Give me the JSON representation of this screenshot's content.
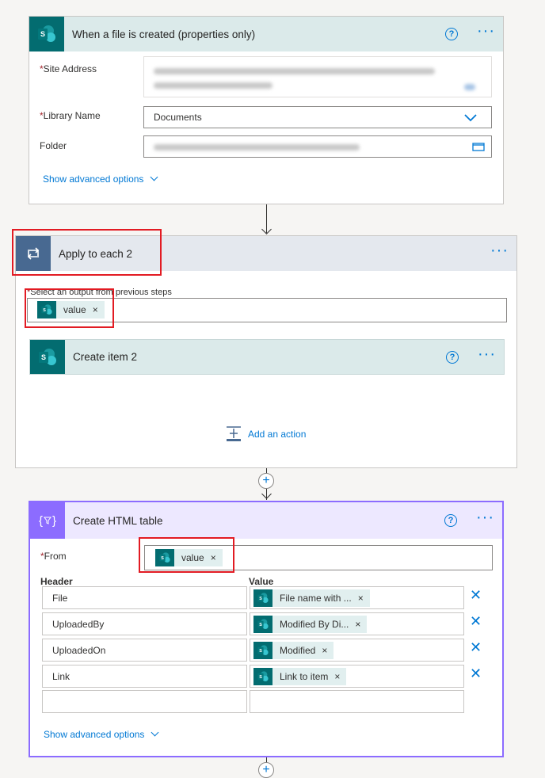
{
  "trigger": {
    "title": "When a file is created (properties only)",
    "fields": {
      "site_address_label": "Site Address",
      "library_label": "Library Name",
      "library_value": "Documents",
      "folder_label": "Folder"
    },
    "advanced_link": "Show advanced options",
    "help_icon": "?",
    "more_icon": "···"
  },
  "loop": {
    "title": "Apply to each 2",
    "select_label": "Select an output from previous steps",
    "token_label": "value",
    "token_remove": "×",
    "more_icon": "···",
    "inner_action": {
      "title": "Create item 2",
      "help_icon": "?",
      "more_icon": "···"
    },
    "add_action_label": "Add an action"
  },
  "html_table": {
    "title": "Create HTML table",
    "help_icon": "?",
    "more_icon": "···",
    "from_label": "From",
    "from_token": "value",
    "header_col": "Header",
    "value_col": "Value",
    "rows": [
      {
        "header": "File",
        "value": "File name with ..."
      },
      {
        "header": "UploadedBy",
        "value": "Modified By Di..."
      },
      {
        "header": "UploadedOn",
        "value": "Modified"
      },
      {
        "header": "Link",
        "value": "Link to item"
      }
    ],
    "token_remove": "×",
    "row_delete": "✕",
    "advanced_link": "Show advanced options"
  },
  "icons": {
    "sharepoint": "sharepoint-icon",
    "loop": "loop-icon",
    "data_operation": "data-operation-icon",
    "add": "+"
  },
  "colors": {
    "sharepoint_tile": "#036c70",
    "sharepoint_header": "#dbeaea",
    "loop_tile": "#486991",
    "loop_header": "#e4e8ee",
    "data_op_tile": "#8c6cff",
    "data_op_header": "#ede8ff",
    "accent": "#0078d4",
    "annotation": "#e21b23"
  }
}
